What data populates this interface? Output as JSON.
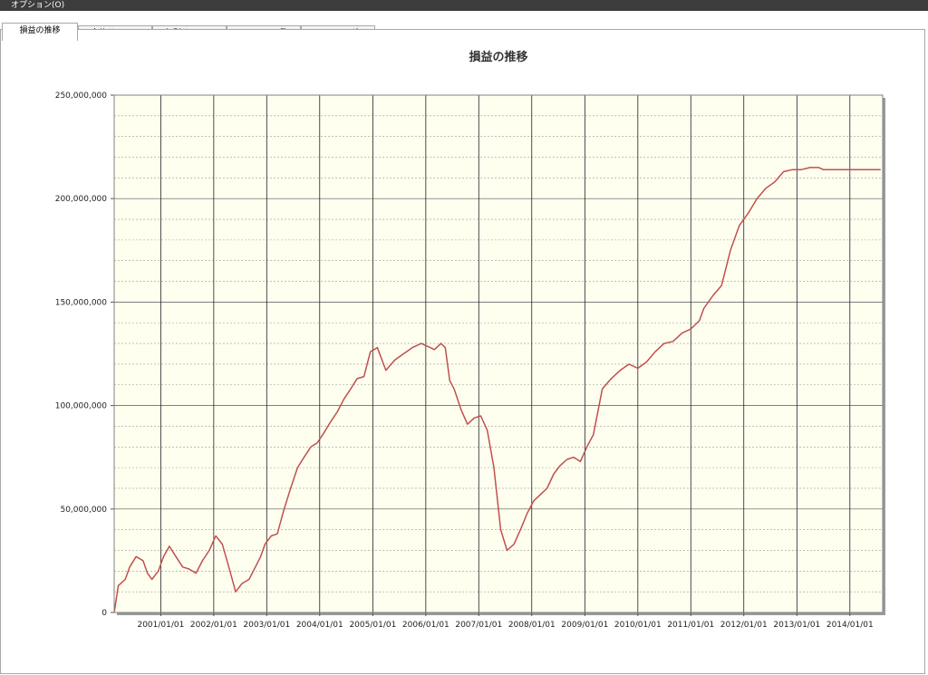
{
  "menu": {
    "options_label": "オプション(O)"
  },
  "tabs": [
    {
      "label": "損益の推移",
      "active": true
    },
    {
      "label": "全体サマリー",
      "active": false
    },
    {
      "label": "年別サマリー",
      "active": false
    },
    {
      "label": "トレード一覧",
      "active": false
    },
    {
      "label": "ランキング",
      "active": false
    }
  ],
  "chart_data": {
    "type": "line",
    "title": "損益の推移",
    "xlabel": "",
    "ylabel": "",
    "ylim": [
      0,
      250000000
    ],
    "y_ticks": [
      "0",
      "50,000,000",
      "100,000,000",
      "150,000,000",
      "200,000,000",
      "250,000,000"
    ],
    "x_ticks": [
      "2001/01/01",
      "2002/01/01",
      "2003/01/01",
      "2004/01/01",
      "2005/01/01",
      "2006/01/01",
      "2007/01/01",
      "2008/01/01",
      "2009/01/01",
      "2010/01/01",
      "2011/01/01",
      "2012/01/01",
      "2013/01/01",
      "2014/01/01"
    ],
    "xlim": [
      "2000/02/15",
      "2014/08/15"
    ],
    "grid": true,
    "line_color": "#c0504d",
    "plot_background": "#fffff0",
    "series": [
      {
        "x": [
          "2000/02/15",
          "2000/03/15",
          "2000/05/01",
          "2000/06/01",
          "2000/07/15",
          "2000/09/01",
          "2000/10/01",
          "2000/11/01",
          "2000/12/15",
          "2001/01/20",
          "2001/03/01",
          "2001/04/15",
          "2001/06/01",
          "2001/07/15",
          "2001/09/01",
          "2001/10/15",
          "2001/12/01",
          "2002/01/15",
          "2002/03/01",
          "2002/04/15",
          "2002/06/01",
          "2002/07/15",
          "2002/09/01",
          "2002/10/15",
          "2002/11/20",
          "2002/12/20",
          "2003/02/01",
          "2003/03/15",
          "2003/05/01",
          "2003/06/15",
          "2003/08/01",
          "2003/09/15",
          "2003/11/01",
          "2003/12/15",
          "2004/02/01",
          "2004/03/15",
          "2004/05/01",
          "2004/06/15",
          "2004/08/01",
          "2004/09/15",
          "2004/11/01",
          "2004/12/15",
          "2005/02/01",
          "2005/04/01",
          "2005/06/01",
          "2005/08/01",
          "2005/10/01",
          "2005/12/01",
          "2006/01/01",
          "2006/02/01",
          "2006/03/01",
          "2006/04/15",
          "2006/05/15",
          "2006/06/15",
          "2006/07/15",
          "2006/09/01",
          "2006/10/15",
          "2006/12/01",
          "2007/01/15",
          "2007/03/01",
          "2007/04/15",
          "2007/06/01",
          "2007/07/15",
          "2007/09/01",
          "2007/10/15",
          "2007/12/01",
          "2008/01/15",
          "2008/03/01",
          "2008/04/15",
          "2008/06/01",
          "2008/07/15",
          "2008/09/01",
          "2008/10/15",
          "2008/12/01",
          "2009/01/15",
          "2009/03/01",
          "2009/05/01",
          "2009/07/01",
          "2009/09/01",
          "2009/11/01",
          "2010/01/01",
          "2010/03/01",
          "2010/05/01",
          "2010/07/01",
          "2010/09/01",
          "2010/11/01",
          "2011/01/01",
          "2011/03/01",
          "2011/04/01",
          "2011/06/01",
          "2011/08/01",
          "2011/10/01",
          "2011/12/01",
          "2012/02/01",
          "2012/04/01",
          "2012/06/01",
          "2012/08/01",
          "2012/10/01",
          "2012/12/01",
          "2013/02/01",
          "2013/04/01",
          "2013/06/01",
          "2013/07/01",
          "2013/08/01",
          "2013/10/01",
          "2013/12/01",
          "2014/02/01",
          "2014/04/01",
          "2014/06/01",
          "2014/08/01"
        ],
        "values": [
          0,
          13000000,
          16000000,
          22000000,
          27000000,
          25000000,
          19000000,
          16000000,
          20000000,
          27000000,
          32000000,
          27000000,
          22000000,
          21000000,
          19000000,
          25000000,
          30000000,
          37000000,
          33000000,
          22000000,
          10000000,
          14000000,
          16000000,
          22000000,
          27000000,
          33000000,
          37000000,
          38000000,
          50000000,
          60000000,
          70000000,
          75000000,
          80000000,
          82000000,
          87000000,
          92000000,
          97000000,
          103000000,
          108000000,
          113000000,
          114000000,
          126000000,
          128000000,
          117000000,
          122000000,
          125000000,
          128000000,
          130000000,
          129000000,
          128000000,
          127000000,
          130000000,
          128000000,
          112000000,
          108000000,
          98000000,
          91000000,
          94000000,
          95000000,
          88000000,
          70000000,
          40000000,
          30000000,
          33000000,
          40000000,
          48000000,
          54000000,
          57000000,
          60000000,
          67000000,
          71000000,
          74000000,
          75000000,
          73000000,
          80000000,
          86000000,
          108000000,
          113000000,
          117000000,
          120000000,
          118000000,
          121000000,
          126000000,
          130000000,
          131000000,
          135000000,
          137000000,
          141000000,
          147000000,
          153000000,
          158000000,
          175000000,
          187000000,
          193000000,
          200000000,
          205000000,
          208000000,
          213000000,
          214000000,
          214000000,
          215000000,
          215000000,
          214000000,
          214000000,
          214000000,
          214000000,
          214000000,
          214000000,
          214000000,
          214000000
        ]
      }
    ]
  }
}
